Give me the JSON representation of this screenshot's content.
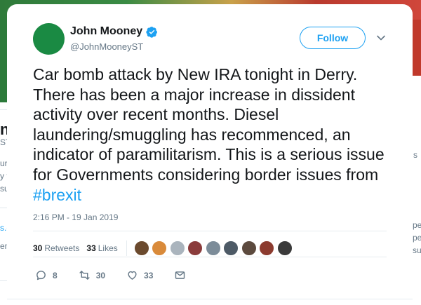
{
  "background": {
    "left_fragments": [
      "n",
      "ST",
      "urr",
      "y th",
      "sue",
      "s.c",
      "em"
    ],
    "right_fragments": [
      "s",
      "pe",
      "pe",
      "su"
    ]
  },
  "tweet": {
    "author": {
      "display_name": "John Mooney",
      "handle": "@JohnMooneyST",
      "verified": true,
      "avatar_color": "#1a8a43"
    },
    "follow_label": "Follow",
    "text_before_hashtag": "Car bomb attack by New IRA tonight in Derry. There has been a major increase in dissident activity over recent months. Diesel laundering/smuggling has recommenced, an indicator of paramilitarism. This is a serious issue for Governments considering border issues from ",
    "hashtag": "#brexit",
    "timestamp": "2:16 PM - 19 Jan 2019",
    "stats": {
      "retweets_count": "30",
      "retweets_label": "Retweets",
      "likes_count": "33",
      "likes_label": "Likes"
    },
    "liker_avatar_colors": [
      "#6b4a2e",
      "#d98a3a",
      "#aab4bd",
      "#8a3b3b",
      "#7c8c99",
      "#4d5a66",
      "#5c4a3e",
      "#8c3b2f",
      "#3a3a3a"
    ],
    "actions": {
      "reply_count": "8",
      "retweet_count": "30",
      "like_count": "33"
    }
  },
  "colors": {
    "accent": "#1da1f2",
    "text_primary": "#14171a",
    "text_secondary": "#657786"
  }
}
